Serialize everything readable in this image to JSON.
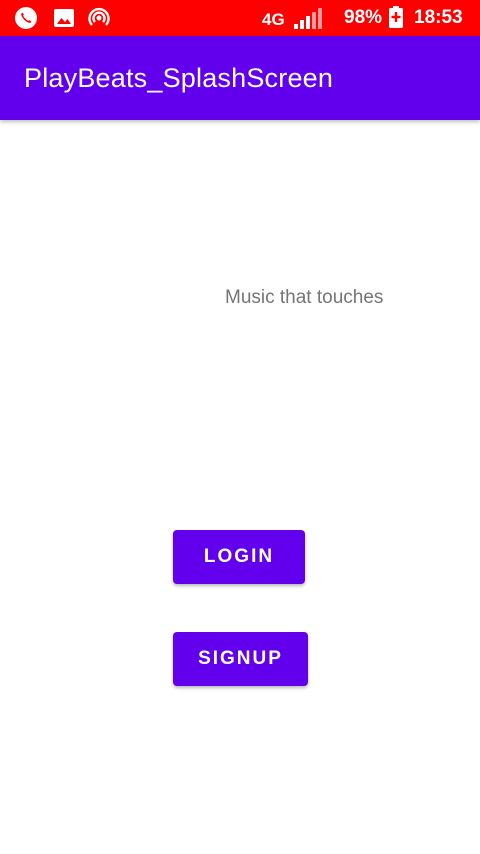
{
  "status_bar": {
    "background": "#ff0000",
    "network": "4G",
    "battery": "98%",
    "time": "18:53",
    "icons": [
      "whatsapp-icon",
      "gallery-icon",
      "hotspot-icon",
      "signal-icon",
      "battery-charging-icon"
    ]
  },
  "app_bar": {
    "title": "PlayBeats_SplashScreen",
    "background": "#6200ee"
  },
  "main": {
    "tagline": "Music that touches",
    "login_label": "LOGIN",
    "signup_label": "SIGNUP",
    "accent": "#6200ee"
  }
}
